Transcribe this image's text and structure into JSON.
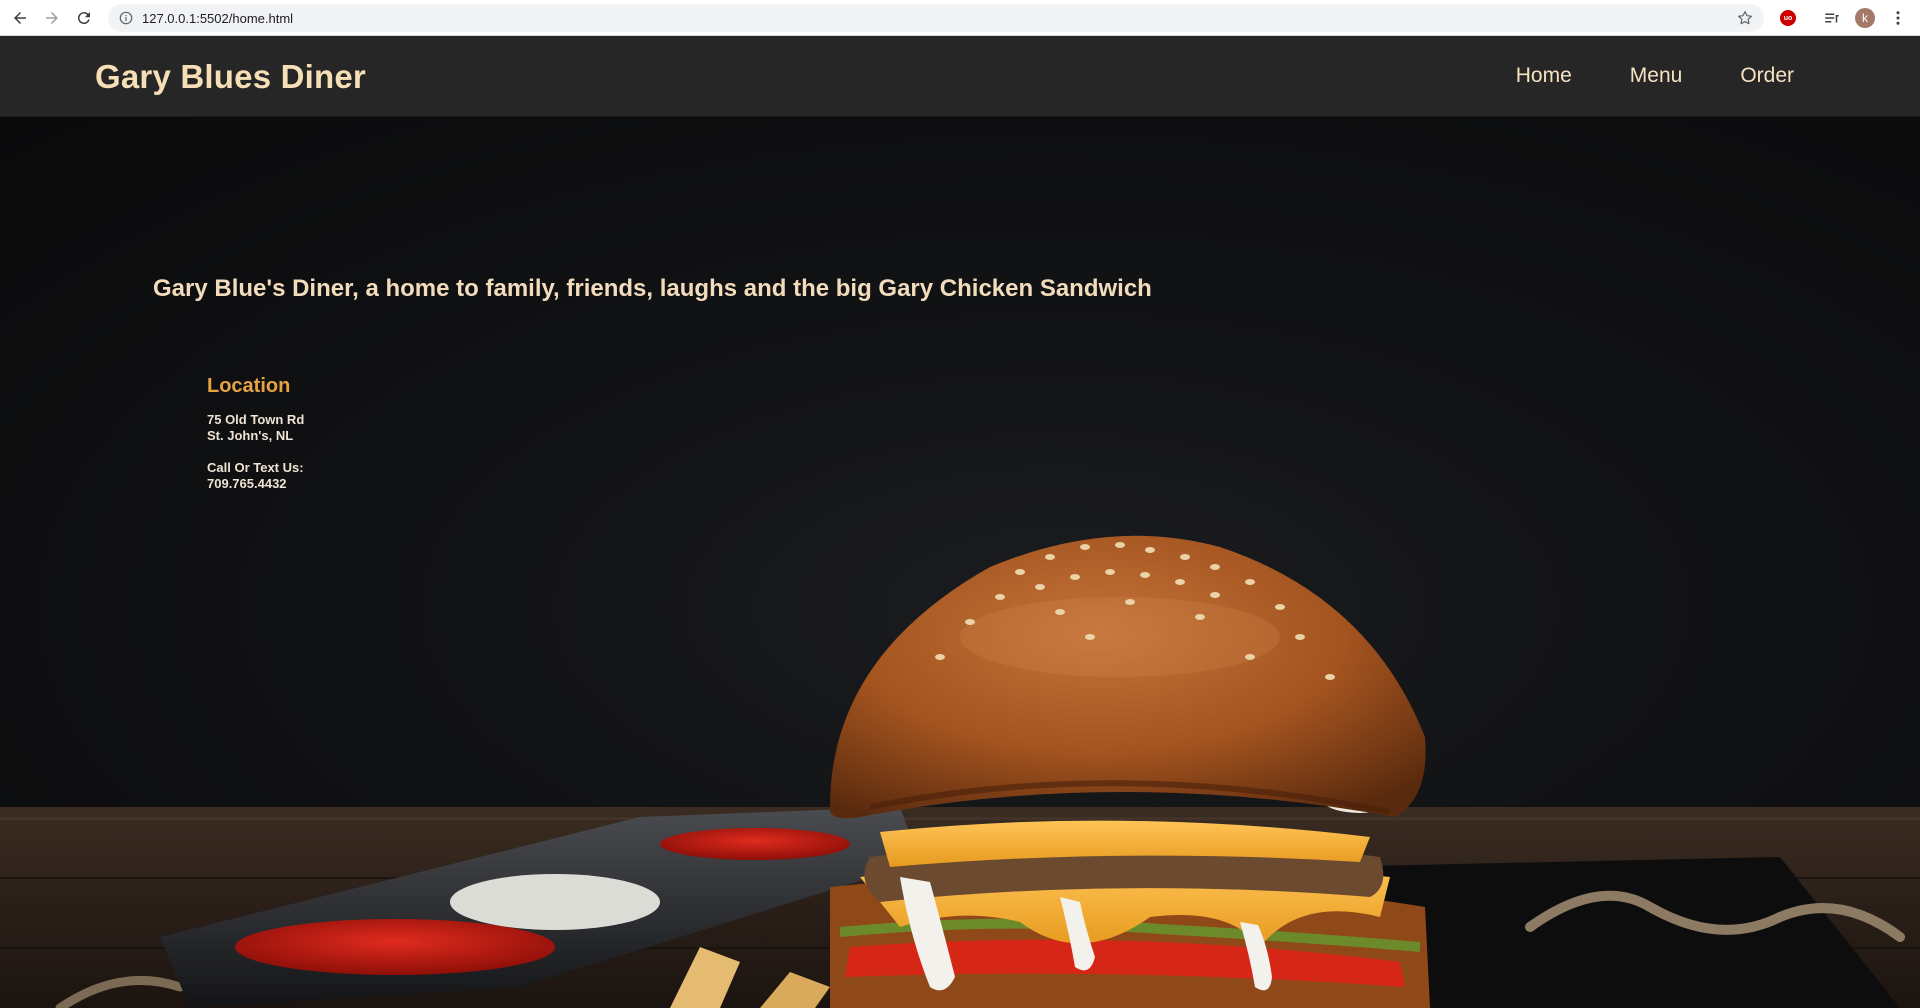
{
  "browser": {
    "url": "127.0.0.1:5502/home.html",
    "profile_initial": "k",
    "extension_label": "uo",
    "icons": {
      "back": "arrow-left-icon",
      "forward": "arrow-right-icon",
      "reload": "reload-icon",
      "info": "info-icon",
      "bookmark": "star-icon",
      "reading_list": "reading-list-icon",
      "menu": "kebab-menu-icon"
    }
  },
  "header": {
    "brand": "Gary Blues Diner",
    "nav": [
      {
        "label": "Home"
      },
      {
        "label": "Menu"
      },
      {
        "label": "Order"
      }
    ]
  },
  "hero": {
    "tagline": "Gary Blue's Diner, a home to family, friends, laughs and the big Gary Chicken Sandwich",
    "location": {
      "title": "Location",
      "address_line1": "75 Old Town Rd",
      "address_line2": "St. John's, NL",
      "contact_label": "Call Or Text Us:",
      "phone": "709.765.4432"
    }
  },
  "colors": {
    "header_bg": "#262626",
    "brand": "#f6dfb6",
    "nav_text": "#f6e2c0",
    "tagline": "#f2dcbc",
    "location_title": "#e7a341",
    "hero_bg": "#111214"
  }
}
